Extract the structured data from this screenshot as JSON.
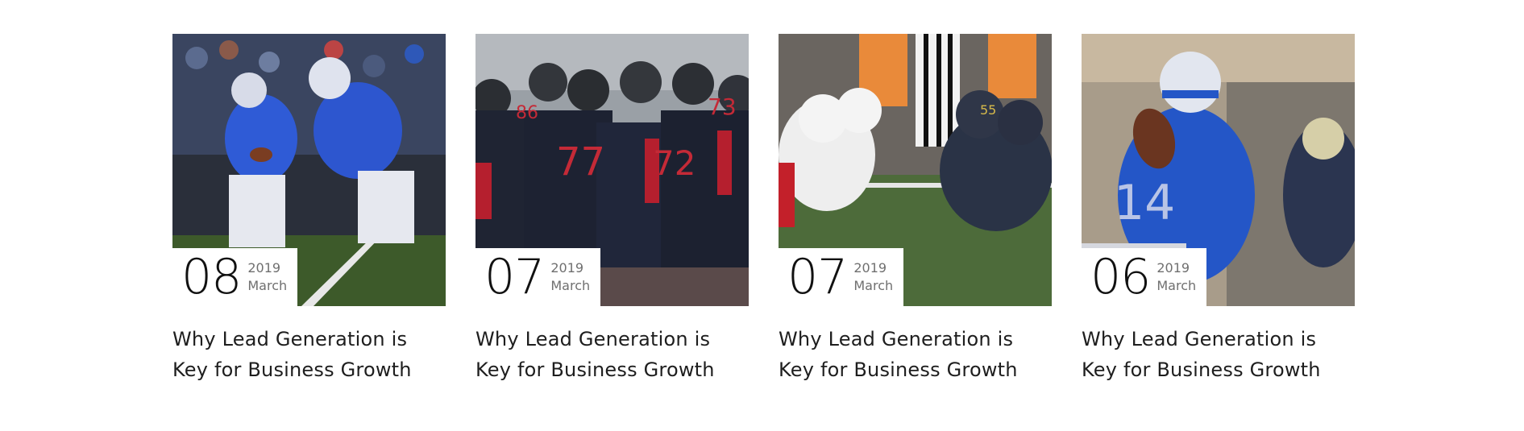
{
  "posts": [
    {
      "day": "08",
      "year": "2019",
      "month": "March",
      "title": "Why Lead Generation is Key for Business Growth",
      "image_theme": "blue-white-football-snap"
    },
    {
      "day": "07",
      "year": "2019",
      "month": "March",
      "title": "Why Lead Generation is Key for Business Growth",
      "image_theme": "black-red-football-huddle"
    },
    {
      "day": "07",
      "year": "2019",
      "month": "March",
      "title": "Why Lead Generation is Key for Business Growth",
      "image_theme": "white-red-vs-navy-line-of-scrimmage"
    },
    {
      "day": "06",
      "year": "2019",
      "month": "March",
      "title": "Why Lead Generation is Key for Business Growth",
      "image_theme": "blue-quarterback-with-ball"
    }
  ],
  "colors": {
    "background": "#ffffff",
    "title_text": "#1e1e1e",
    "date_meta_text": "#6f6f6f",
    "day_text": "#111111"
  }
}
